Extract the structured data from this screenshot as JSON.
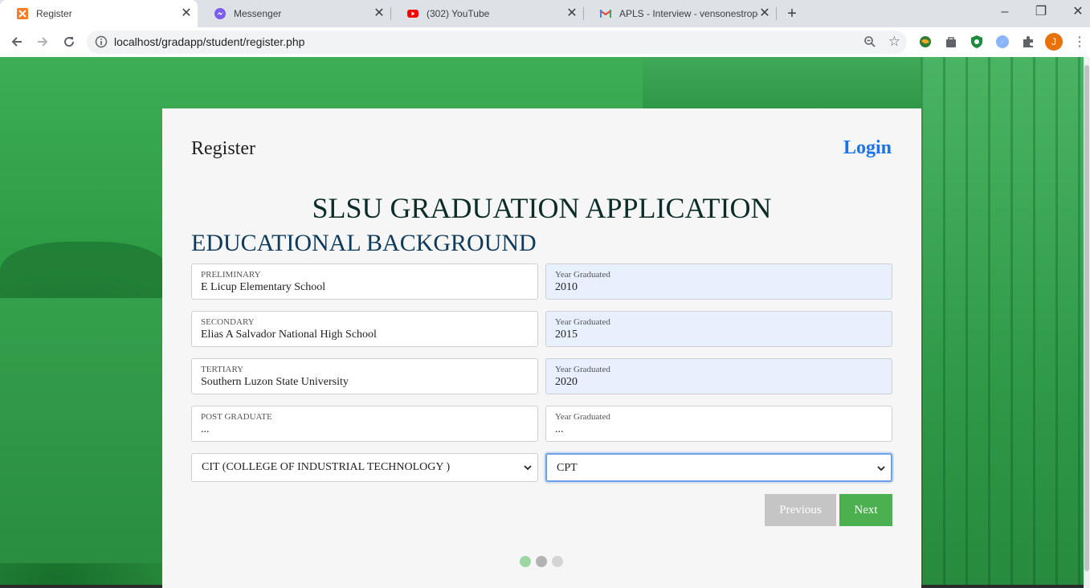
{
  "browser": {
    "tabs": [
      {
        "title": "Register",
        "icon": "xampp-icon",
        "active": true
      },
      {
        "title": "Messenger",
        "icon": "messenger-icon",
        "active": false
      },
      {
        "title": "(302) YouTube",
        "icon": "youtube-icon",
        "active": false
      },
      {
        "title": "APLS - Interview - vensonestrope",
        "icon": "gmail-icon",
        "active": false
      }
    ],
    "url": "localhost/gradapp/student/register.php",
    "profile_initial": "J"
  },
  "page": {
    "header": {
      "title": "Register",
      "login_label": "Login"
    },
    "app_title": "SLSU GRADUATION APPLICATION",
    "section_title": "EDUCATIONAL BACKGROUND",
    "rows": [
      {
        "school_label": "PRELIMINARY",
        "school_value": "E Licup Elementary School",
        "year_label": "Year Graduated",
        "year_value": "2010"
      },
      {
        "school_label": "SECONDARY",
        "school_value": "Elias A Salvador National High School",
        "year_label": "Year Graduated",
        "year_value": "2015"
      },
      {
        "school_label": "TERTIARY",
        "school_value": "Southern Luzon State University",
        "year_label": "Year Graduated",
        "year_value": "2020"
      },
      {
        "school_label": "POST GRADUATE",
        "school_value": "...",
        "year_label": "Year Graduated",
        "year_value": "..."
      }
    ],
    "college_select": "CIT (COLLEGE OF INDUSTRIAL TECHNOLOGY )",
    "course_select": "CPT",
    "buttons": {
      "previous": "Previous",
      "next": "Next"
    },
    "steps": {
      "total": 3,
      "current": 2
    }
  },
  "colors": {
    "accent": "#1a73e8",
    "next_button": "#4caf50",
    "previous_button": "#c5c5c5",
    "background": "#2d9a44"
  }
}
